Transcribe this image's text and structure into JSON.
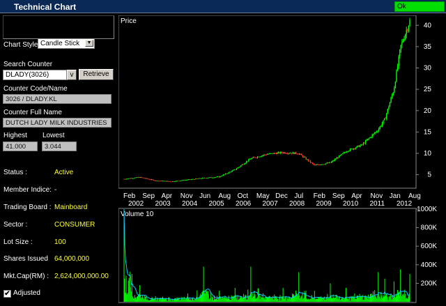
{
  "window": {
    "title": "Technical Chart",
    "status": "Ok"
  },
  "controls": {
    "chart_style_label": "Chart Style:",
    "chart_style_value": "Candle Stick",
    "search_label": "Search Counter",
    "search_value": "DLADY(3026)",
    "search_dropdown": "v",
    "retrieve_label": "Retrieve",
    "code_label": "Counter Code/Name",
    "code_value": "3026 / DLADY.KL",
    "fullname_label": "Counter Full Name",
    "fullname_value": "DUTCH LADY MILK INDUSTRIES",
    "highest_label": "Highest",
    "lowest_label": "Lowest",
    "highest_value": "41.000",
    "lowest_value": "3.044"
  },
  "info": [
    {
      "label": "Status :",
      "value": "Active"
    },
    {
      "label": "Member Indice:",
      "value": "-"
    },
    {
      "label": "Trading Board :",
      "value": "Mainboard"
    },
    {
      "label": "Sector :",
      "value": "CONSUMER"
    },
    {
      "label": "Lot Size :",
      "value": "100"
    },
    {
      "label": "Shares Issued",
      "value": "64,000,000"
    },
    {
      "label": "Mkt.Cap(RM) :",
      "value": "2,624,000,000.00"
    }
  ],
  "adjusted": {
    "label": "Adjusted",
    "checked": true,
    "mark": "✔"
  },
  "colors": {
    "up": "#00ff00",
    "down": "#ff3333",
    "volume": "#00ff00",
    "volume_ma": "#00ccff",
    "grid": "#444444"
  },
  "chart_data": [
    {
      "type": "candlestick",
      "title": "Price",
      "ylim": [
        2,
        42
      ],
      "yticks": [
        5,
        10,
        15,
        20,
        25,
        30,
        35,
        40
      ],
      "ytick_labels": [
        "5",
        "10",
        "15",
        "20",
        "25",
        "30",
        "35",
        "40"
      ],
      "x_months": [
        "Feb",
        "Sep",
        "Apr",
        "Nov",
        "Jun",
        "Aug",
        "Oct",
        "May",
        "Dec",
        "Jul",
        "Feb",
        "Sep",
        "Apr",
        "Nov",
        "Jan",
        "Aug"
      ],
      "x_years": [
        "2002",
        "2003",
        "2004",
        "2005",
        "2006",
        "2007",
        "2008",
        "2009",
        "2010",
        "2011",
        "2012"
      ],
      "x": [
        "2002-02",
        "2002-09",
        "2003-04",
        "2003-11",
        "2004-06",
        "2005-01",
        "2005-08",
        "2006-03",
        "2006-10",
        "2007-05",
        "2007-12",
        "2008-07",
        "2009-02",
        "2009-09",
        "2010-04",
        "2010-11",
        "2011-06",
        "2011-09",
        "2012-01",
        "2012-04",
        "2012-08"
      ],
      "close": [
        4.0,
        4.4,
        3.6,
        3.4,
        3.8,
        4.2,
        4.5,
        6.2,
        8.8,
        9.8,
        10.2,
        10.0,
        7.2,
        7.8,
        10.5,
        12.0,
        15.5,
        18.0,
        25.0,
        35.0,
        41.0
      ]
    },
    {
      "type": "bar",
      "title": "Volume 10",
      "ylim": [
        0,
        1000000
      ],
      "yticks": [
        200000,
        400000,
        600000,
        800000,
        1000000
      ],
      "ytick_labels": [
        "200K",
        "400K",
        "600K",
        "800K",
        "1000K"
      ],
      "x": [
        "2002-02",
        "2002-09",
        "2003-04",
        "2003-11",
        "2004-06",
        "2005-01",
        "2005-08",
        "2006-03",
        "2006-10",
        "2007-05",
        "2007-12",
        "2008-07",
        "2009-02",
        "2009-09",
        "2010-04",
        "2010-11",
        "2011-06",
        "2011-09",
        "2012-01",
        "2012-04",
        "2012-08"
      ],
      "volume": [
        1000000,
        180000,
        60000,
        70000,
        90000,
        380000,
        120000,
        150000,
        380000,
        200000,
        150000,
        320000,
        120000,
        200000,
        150000,
        180000,
        320000,
        250000,
        220000,
        350000,
        300000
      ]
    }
  ]
}
